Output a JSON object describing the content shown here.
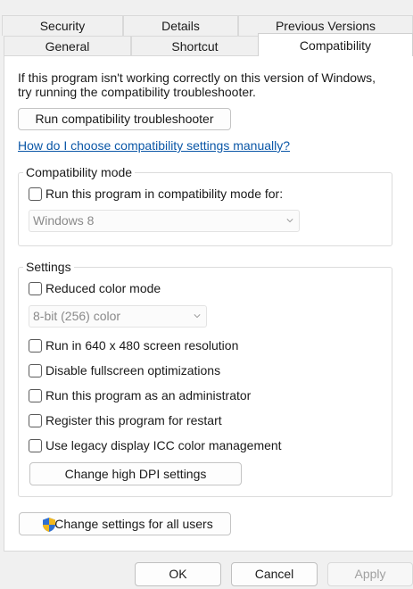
{
  "tabs_top": [
    "Security",
    "Details",
    "Previous Versions"
  ],
  "tabs_bottom": [
    "General",
    "Shortcut",
    "Compatibility"
  ],
  "intro_text": "If this program isn't working correctly on this version of Windows, try running the compatibility troubleshooter.",
  "run_troubleshooter_label": "Run compatibility troubleshooter",
  "manual_link": "How do I choose compatibility settings manually?",
  "compat_mode": {
    "legend": "Compatibility mode",
    "checkbox_label": "Run this program in compatibility mode for:",
    "checked": false,
    "select_value": "Windows 8"
  },
  "settings": {
    "legend": "Settings",
    "reduced_color_label": "Reduced color mode",
    "color_select_value": "8-bit (256) color",
    "options": [
      {
        "label": "Run in 640 x 480 screen resolution",
        "checked": false
      },
      {
        "label": "Disable fullscreen optimizations",
        "checked": false
      },
      {
        "label": "Run this program as an administrator",
        "checked": false
      },
      {
        "label": "Register this program for restart",
        "checked": false
      },
      {
        "label": "Use legacy display ICC color management",
        "checked": false
      }
    ],
    "high_dpi_label": "Change high DPI settings"
  },
  "all_users_label": "Change settings for all users",
  "footer": {
    "ok": "OK",
    "cancel": "Cancel",
    "apply": "Apply"
  },
  "icons": {
    "shield": "uac-shield-icon",
    "chevron": "chevron-down-icon"
  }
}
